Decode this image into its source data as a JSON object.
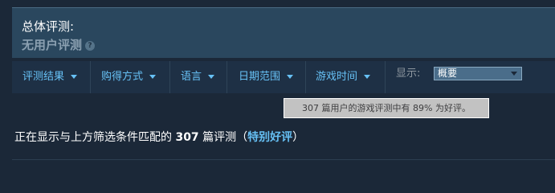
{
  "summary_panel": {
    "title": "总体评测:",
    "summary": "无用户评测",
    "help_icon": "?"
  },
  "filters": {
    "items": [
      {
        "label": "评测结果"
      },
      {
        "label": "购得方式"
      },
      {
        "label": "语言"
      },
      {
        "label": "日期范围"
      },
      {
        "label": "游戏时间"
      }
    ],
    "display_label": "显示:",
    "display_selected": "概要"
  },
  "tooltip": "307 篇用户的游戏评测中有 89% 为好评。",
  "results": {
    "prefix": "正在显示与上方筛选条件匹配的",
    "count": "307",
    "suffix": "篇评测（",
    "rating": "特别好评",
    "close": "）"
  },
  "colors": {
    "background": "#1b2838",
    "panel": "#2a475e",
    "link": "#67c1f5",
    "rating": "#66c0f4"
  }
}
